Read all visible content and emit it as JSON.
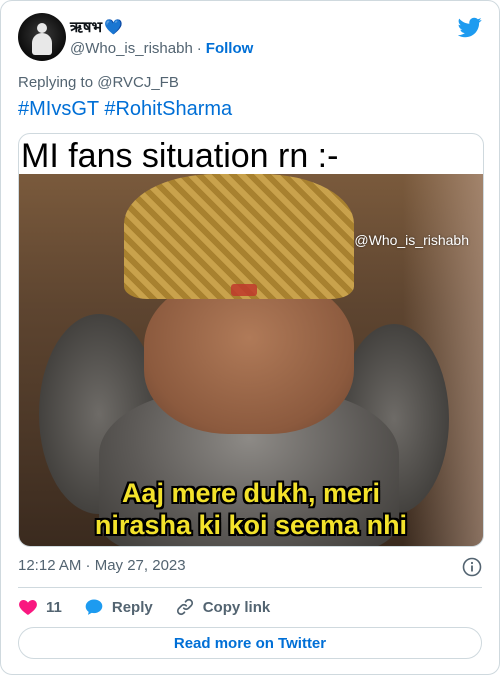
{
  "author": {
    "display_name": "ऋषभ",
    "emoji": "💙",
    "handle": "@Who_is_rishabh",
    "separator": "·",
    "follow_label": "Follow"
  },
  "reply": {
    "replying_to": "Replying to @RVCJ_FB"
  },
  "tweet": {
    "hashtag_1": "#MIvsGT",
    "hashtag_2": "#RohitSharma"
  },
  "media": {
    "top_text": "MI fans situation rn :-",
    "watermark": "@Who_is_rishabh",
    "subtitle_line_1": "Aaj mere dukh, meri",
    "subtitle_line_2": "nirasha ki koi seema nhi"
  },
  "meta": {
    "timestamp": "12:12 AM · May 27, 2023"
  },
  "actions": {
    "like_count": "11",
    "reply_label": "Reply",
    "copy_label": "Copy link"
  },
  "footer": {
    "read_more_label": "Read more on Twitter"
  },
  "colors": {
    "brand_blue": "#1d9bf0",
    "link_blue": "#006fd6",
    "like_pink": "#f91880",
    "muted_text": "#536471",
    "border": "#cfd9de",
    "subtitle_yellow": "#f3e22b"
  },
  "icons": {
    "brand": "twitter-bird-icon",
    "info": "info-icon",
    "like": "heart-icon",
    "reply": "speech-bubble-icon",
    "copy": "link-icon"
  }
}
